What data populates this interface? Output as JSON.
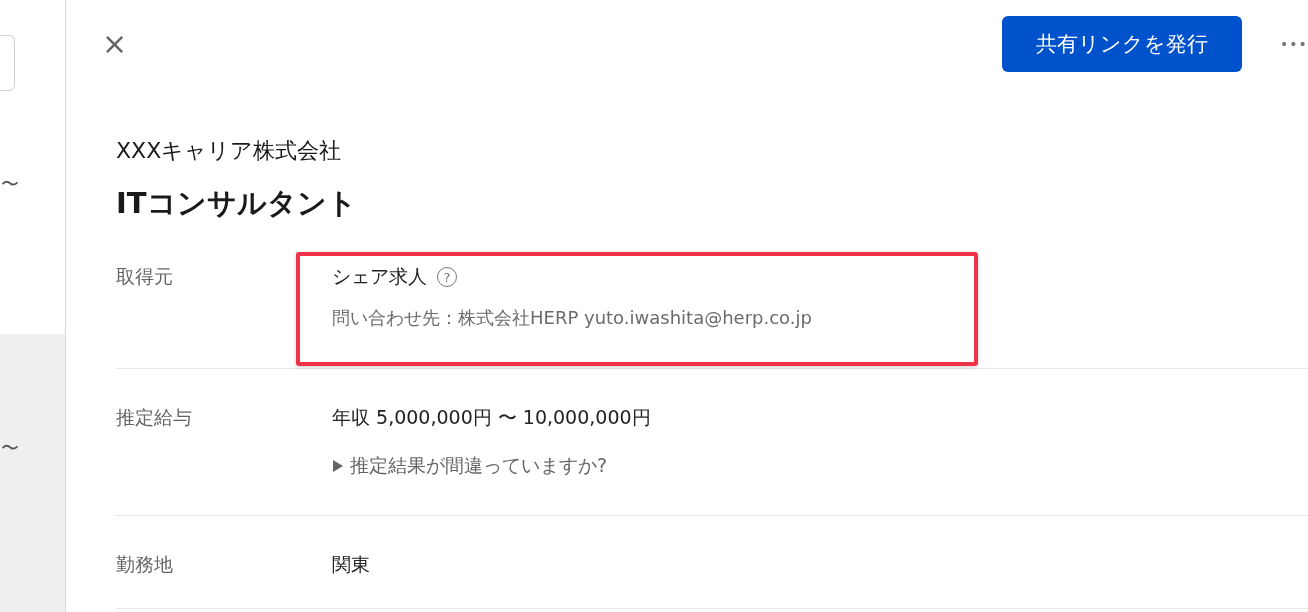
{
  "sidebar": {
    "items": [
      {
        "text": "〜",
        "selected": false
      },
      {
        "text": "〜",
        "selected": true
      }
    ]
  },
  "header": {
    "close": "×",
    "share_button": "共有リンクを発行",
    "more": "•••"
  },
  "company": "XXXキャリア株式会社",
  "job_title": "ITコンサルタント",
  "fields": [
    {
      "kind": "source",
      "label": "取得元",
      "value": "シェア求人",
      "help": "?",
      "note": "問い合わせ先：株式会社HERP yuto.iwashita@herp.co.jp",
      "highlighted": true
    },
    {
      "kind": "salary",
      "label": "推定給与",
      "value": "年収 5,000,000円 〜 10,000,000円",
      "disclosure": "推定結果が間違っていますか?",
      "expanded": false
    },
    {
      "kind": "plain",
      "label": "勤務地",
      "value": "関東"
    }
  ]
}
